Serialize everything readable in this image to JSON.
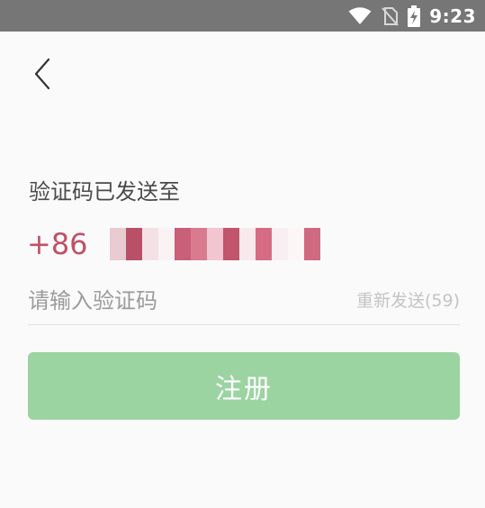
{
  "status_bar": {
    "time": "9:23",
    "icons": [
      "wifi-icon",
      "no-sim-icon",
      "battery-charging-icon"
    ]
  },
  "header": {
    "back_icon": "chevron-left-icon"
  },
  "main": {
    "title": "验证码已发送至",
    "phone_prefix": "+86",
    "code_placeholder": "请输入验证码",
    "resend_label": "重新发送(59)",
    "register_label": "注册"
  },
  "colors": {
    "status_bar_bg": "#767676",
    "page_bg": "#fafafa",
    "accent_red": "#c05067",
    "button_green": "#9bd3a1",
    "muted_text": "#c4c4c4"
  }
}
